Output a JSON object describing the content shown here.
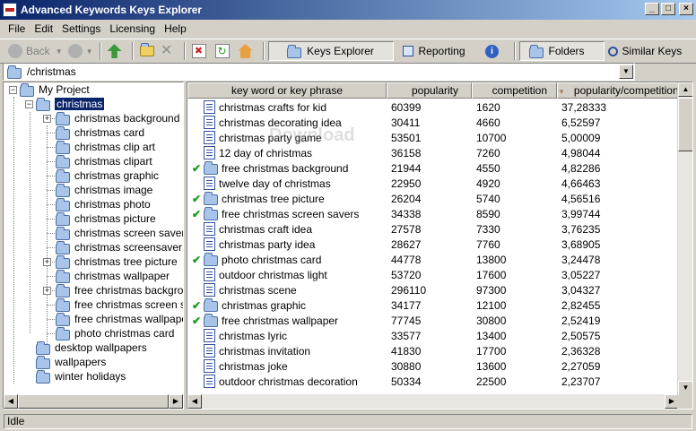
{
  "window": {
    "title": "Advanced Keywords Keys Explorer"
  },
  "menu": [
    "File",
    "Edit",
    "Settings",
    "Licensing",
    "Help"
  ],
  "toolbar": {
    "back": "Back",
    "tabs": {
      "explorer": "Keys Explorer",
      "reporting": "Reporting",
      "folders": "Folders",
      "similar": "Similar Keys"
    }
  },
  "path": "/christmas",
  "tree": {
    "root": "My Project",
    "selected": "christmas",
    "children": [
      "christmas background",
      "christmas card",
      "christmas clip art",
      "christmas clipart",
      "christmas graphic",
      "christmas image",
      "christmas photo",
      "christmas picture",
      "christmas screen savers",
      "christmas screensaver",
      "christmas tree picture",
      "christmas wallpaper",
      "free christmas backgroun",
      "free christmas screen sav",
      "free christmas wallpaper",
      "photo christmas card"
    ],
    "siblings": [
      "desktop wallpapers",
      "wallpapers",
      "winter holidays"
    ]
  },
  "grid": {
    "columns": {
      "keyword": "key word or key phrase",
      "popularity": "popularity",
      "competition": "competition",
      "ratio": "popularity/competition"
    },
    "rows": [
      {
        "k": "christmas crafts for kid",
        "p": "60399",
        "c": "1620",
        "r": "37,28333",
        "icon": "doc",
        "check": false
      },
      {
        "k": "christmas decorating idea",
        "p": "30411",
        "c": "4660",
        "r": "6,52597",
        "icon": "doc",
        "check": false
      },
      {
        "k": "christmas party game",
        "p": "53501",
        "c": "10700",
        "r": "5,00009",
        "icon": "doc",
        "check": false
      },
      {
        "k": "12 day of christmas",
        "p": "36158",
        "c": "7260",
        "r": "4,98044",
        "icon": "doc",
        "check": false
      },
      {
        "k": "free christmas background",
        "p": "21944",
        "c": "4550",
        "r": "4,82286",
        "icon": "folder",
        "check": true
      },
      {
        "k": "twelve day of christmas",
        "p": "22950",
        "c": "4920",
        "r": "4,66463",
        "icon": "doc",
        "check": false
      },
      {
        "k": "christmas tree picture",
        "p": "26204",
        "c": "5740",
        "r": "4,56516",
        "icon": "folder",
        "check": true
      },
      {
        "k": "free christmas screen savers",
        "p": "34338",
        "c": "8590",
        "r": "3,99744",
        "icon": "folder",
        "check": true
      },
      {
        "k": "christmas craft idea",
        "p": "27578",
        "c": "7330",
        "r": "3,76235",
        "icon": "doc",
        "check": false
      },
      {
        "k": "christmas party idea",
        "p": "28627",
        "c": "7760",
        "r": "3,68905",
        "icon": "doc",
        "check": false
      },
      {
        "k": "photo christmas card",
        "p": "44778",
        "c": "13800",
        "r": "3,24478",
        "icon": "folder",
        "check": true
      },
      {
        "k": "outdoor christmas light",
        "p": "53720",
        "c": "17600",
        "r": "3,05227",
        "icon": "doc",
        "check": false
      },
      {
        "k": "christmas scene",
        "p": "296110",
        "c": "97300",
        "r": "3,04327",
        "icon": "doc",
        "check": false
      },
      {
        "k": "christmas graphic",
        "p": "34177",
        "c": "12100",
        "r": "2,82455",
        "icon": "folder",
        "check": true
      },
      {
        "k": "free christmas wallpaper",
        "p": "77745",
        "c": "30800",
        "r": "2,52419",
        "icon": "folder",
        "check": true
      },
      {
        "k": "christmas lyric",
        "p": "33577",
        "c": "13400",
        "r": "2,50575",
        "icon": "doc",
        "check": false
      },
      {
        "k": "christmas invitation",
        "p": "41830",
        "c": "17700",
        "r": "2,36328",
        "icon": "doc",
        "check": false
      },
      {
        "k": "christmas joke",
        "p": "30880",
        "c": "13600",
        "r": "2,27059",
        "icon": "doc",
        "check": false
      },
      {
        "k": "outdoor christmas decoration",
        "p": "50334",
        "c": "22500",
        "r": "2,23707",
        "icon": "doc",
        "check": false
      }
    ]
  },
  "status": "Idle",
  "watermark": "Download"
}
